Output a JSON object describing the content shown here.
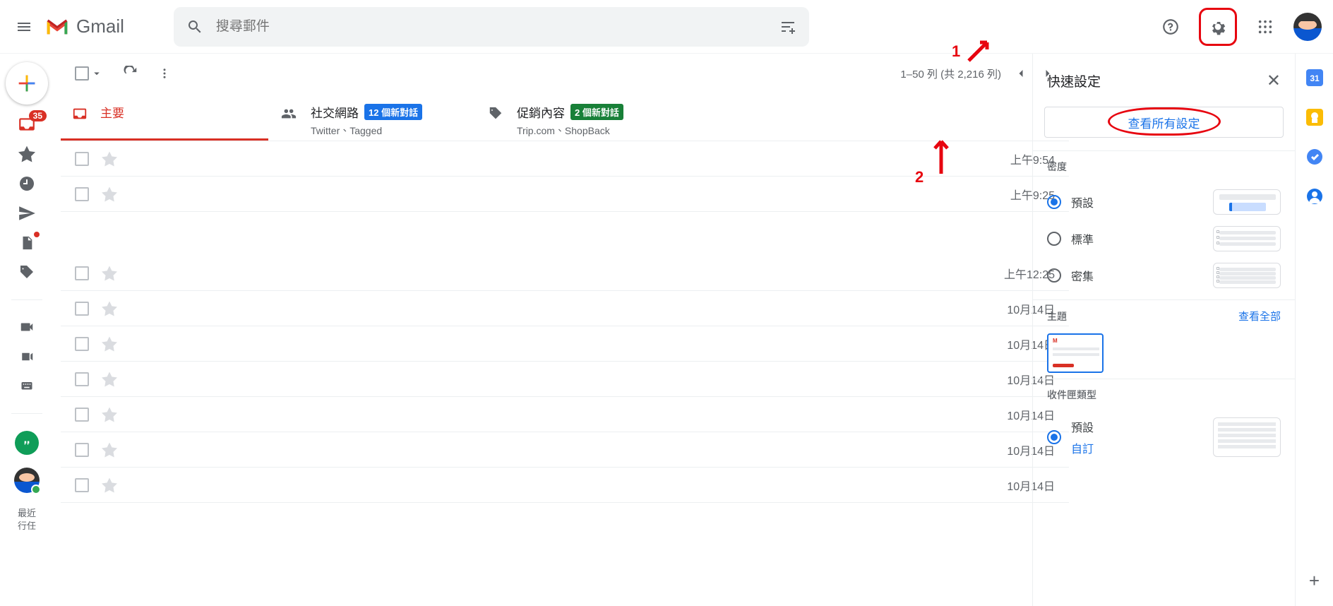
{
  "header": {
    "product": "Gmail",
    "search_placeholder": "搜尋郵件"
  },
  "sidebar": {
    "inbox_badge": "35",
    "recent_text": "最近",
    "recent_text2": "行任"
  },
  "toolbar": {
    "range": "1–50 列 (共 2,216 列)"
  },
  "categories": [
    {
      "name": "主要"
    },
    {
      "name": "社交網路",
      "badge": "12 個新對話",
      "sub": "Twitter、Tagged"
    },
    {
      "name": "促銷內容",
      "badge": "2 個新對話",
      "sub": "Trip.com、ShopBack"
    }
  ],
  "rows": [
    {
      "time": "上午9:54"
    },
    {
      "time": "上午9:25"
    },
    {
      "time": "上午12:25"
    },
    {
      "time": "10月14日"
    },
    {
      "time": "10月14日"
    },
    {
      "time": "10月14日"
    },
    {
      "time": "10月14日"
    },
    {
      "time": "10月14日"
    },
    {
      "time": "10月14日"
    }
  ],
  "quick": {
    "title": "快速設定",
    "view_all": "查看所有設定",
    "density": {
      "title": "密度",
      "default": "預設",
      "standard": "標準",
      "compact": "密集"
    },
    "theme": {
      "title": "主題",
      "view_all": "查看全部"
    },
    "inbox_type": {
      "title": "收件匣類型",
      "default": "預設",
      "custom": "自訂"
    }
  },
  "annotations": {
    "n1": "1",
    "n2": "2"
  }
}
